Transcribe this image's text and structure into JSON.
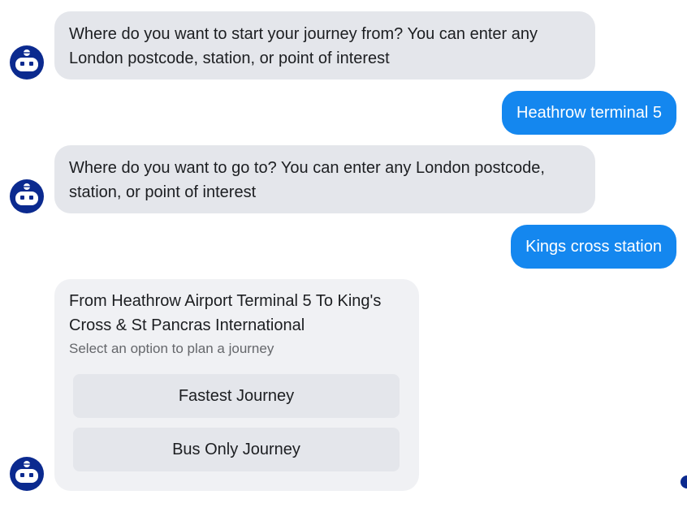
{
  "messages": [
    {
      "from": "bot",
      "text": "Where do you want to start your journey from? You can enter any London postcode, station, or point of interest"
    },
    {
      "from": "user",
      "text": "Heathrow terminal 5"
    },
    {
      "from": "bot",
      "text": "Where do you want to go to? You can enter any London postcode, station, or point of interest"
    },
    {
      "from": "user",
      "text": "Kings cross station"
    }
  ],
  "journey_card": {
    "title": "From Heathrow Airport Terminal 5 To King's Cross & St Pancras International",
    "subtitle": "Select an option to plan a journey",
    "options": [
      "Fastest Journey",
      "Bus Only Journey"
    ]
  },
  "icons": {
    "bot_avatar": "robot-icon"
  },
  "colors": {
    "user_bubble": "#1487ef",
    "bot_bubble": "#e4e6eb",
    "card_background": "#f0f1f4",
    "avatar": "#0b2a8f"
  }
}
